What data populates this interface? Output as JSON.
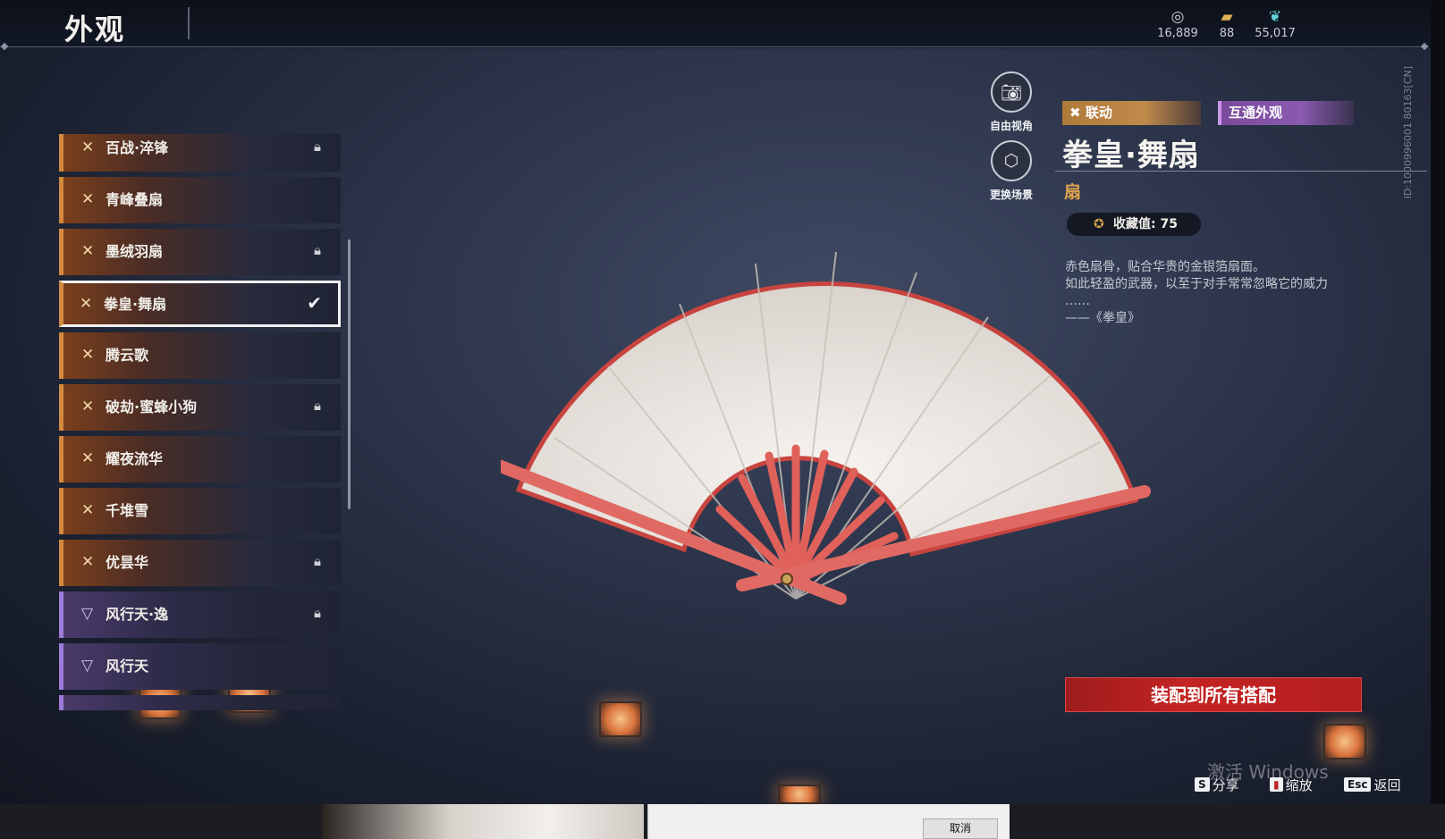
{
  "header": {
    "title": "外观"
  },
  "currencies": [
    {
      "icon": "coin-icon",
      "value": "16,889"
    },
    {
      "icon": "ticket-icon",
      "value": "88"
    },
    {
      "icon": "feather-icon",
      "value": "55,017"
    }
  ],
  "sidebar": {
    "items": [
      {
        "label": "百战·淬锋",
        "locked": true,
        "style": "orange"
      },
      {
        "label": "青峰叠扇",
        "locked": false,
        "style": "orange"
      },
      {
        "label": "墨绒羽扇",
        "locked": true,
        "style": "orange"
      },
      {
        "label": "拳皇·舞扇",
        "locked": false,
        "style": "orange",
        "selected": true
      },
      {
        "label": "腾云歌",
        "locked": false,
        "style": "orange"
      },
      {
        "label": "破劫·蜜蜂小狗",
        "locked": true,
        "style": "orange"
      },
      {
        "label": "耀夜流华",
        "locked": false,
        "style": "orange"
      },
      {
        "label": "千堆雪",
        "locked": false,
        "style": "orange"
      },
      {
        "label": "优昙华",
        "locked": true,
        "style": "orange"
      },
      {
        "label": "风行天·逸",
        "locked": true,
        "style": "purple"
      },
      {
        "label": "风行天",
        "locked": false,
        "style": "purple"
      }
    ]
  },
  "tools": {
    "free_camera": "自由视角",
    "change_scene": "更换场景"
  },
  "detail": {
    "tag_collab": "联动",
    "tag_shared": "互通外观",
    "name": "拳皇·舞扇",
    "type": "扇",
    "collection": "收藏值: 75",
    "desc_lines": [
      "赤色扇骨，贴合华贵的金银箔扇面。",
      "如此轻盈的武器，以至于对手常常忽略它的威力",
      "……",
      "——《拳皇》"
    ],
    "id_text": "ID:1000996001 80163[CN]"
  },
  "equip_button": "装配到所有搭配",
  "watermark": "激活 Windows",
  "hints": [
    {
      "key": "S",
      "label": "分享"
    },
    {
      "key": "",
      "label": "缩放"
    },
    {
      "key": "Esc",
      "label": "返回"
    }
  ],
  "taskbar": {
    "cancel": "取消"
  },
  "colors": {
    "accent_orange": "#d28a40",
    "accent_purple": "#9c7cd8",
    "equip_red": "#c42323",
    "type_gold": "#e1a24d"
  }
}
